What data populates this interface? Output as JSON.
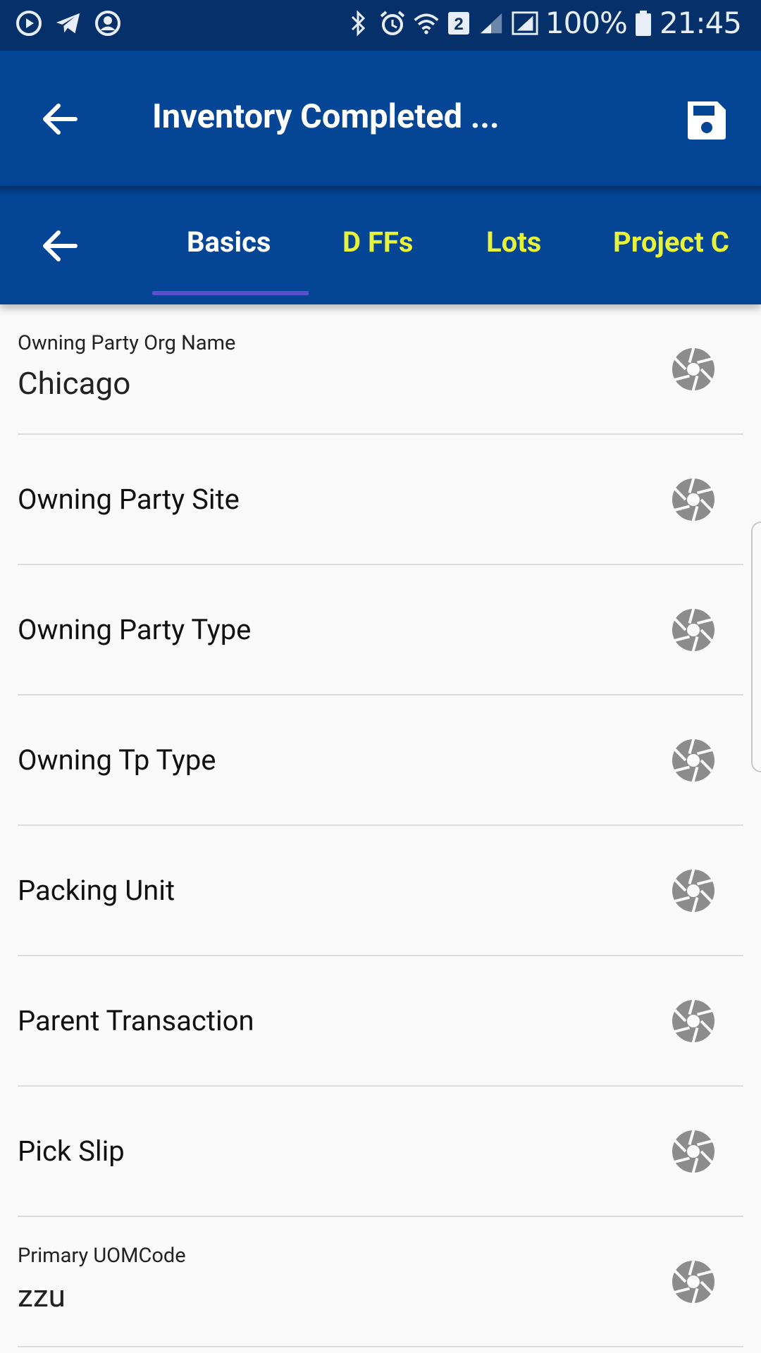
{
  "status_bar": {
    "notifications": [
      "media-icon",
      "telegram-icon",
      "account-icon"
    ],
    "system": [
      "bluetooth-icon",
      "alarm-icon",
      "wifi-icon",
      "sim2-icon",
      "signal-icon",
      "signal-icon"
    ],
    "sim_badge": "2",
    "battery": "100%",
    "time": "21:45"
  },
  "app_bar": {
    "title": "Inventory Completed ...",
    "back_icon": "arrow-left-icon",
    "save_icon": "floppy-disk-icon"
  },
  "tabs": {
    "back_icon": "arrow-left-icon",
    "items": [
      {
        "label": "Basics",
        "active": true
      },
      {
        "label": "D FFs",
        "active": false
      },
      {
        "label": "Lots",
        "active": false
      },
      {
        "label": "Project C",
        "active": false
      }
    ],
    "active_color": "#ffffff",
    "inactive_color": "#e7f23b"
  },
  "fields": [
    {
      "label": "Owning Party Org Name",
      "value": "Chicago"
    },
    {
      "label": "Owning Party Site",
      "value": ""
    },
    {
      "label": "Owning Party Type",
      "value": ""
    },
    {
      "label": "Owning Tp Type",
      "value": ""
    },
    {
      "label": "Packing Unit",
      "value": ""
    },
    {
      "label": "Parent Transaction",
      "value": ""
    },
    {
      "label": "Pick Slip",
      "value": ""
    },
    {
      "label": "Primary UOMCode",
      "value": "zzu"
    }
  ],
  "colors": {
    "status_bar": "#06306a",
    "app_bar": "#054595",
    "tab_indicator": "#5a4fcf",
    "icon_gray": "#8c8c8c"
  }
}
